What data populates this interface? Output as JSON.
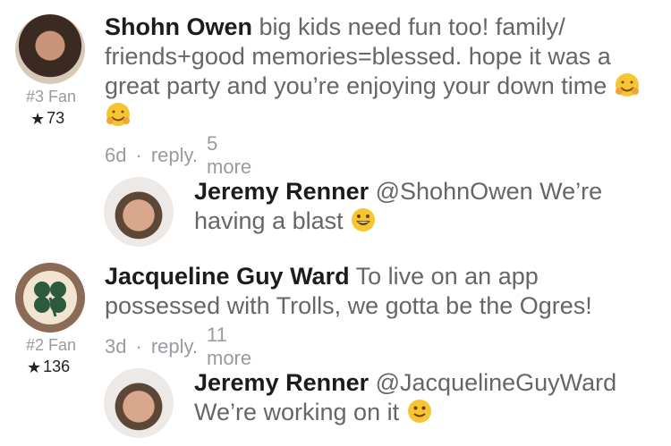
{
  "comments": [
    {
      "author": "Shohn Owen",
      "text": "big kids need fun too! family/ friends+good memories=blessed. hope it was a great party and you’re enjoying your down time",
      "fan_rank": "#3 Fan",
      "fan_score": "73",
      "time": "6d",
      "reply": "reply",
      "more": "5 more",
      "emoji": [
        "hugging-face-icon",
        "hugging-face-icon"
      ]
    },
    {
      "author": "Jeremy Renner",
      "mention": "@ShohnOwen",
      "text": "We’re having a blast",
      "emoji": [
        "grinning-face-icon"
      ]
    },
    {
      "author": "Jacqueline Guy Ward",
      "text": "To live on an app possessed with Trolls, we gotta be the Ogres!",
      "fan_rank": "#2 Fan",
      "fan_score": "136",
      "time": "3d",
      "reply": "reply",
      "more": "11 more"
    },
    {
      "author": "Jeremy Renner",
      "mention": "@JacquelineGuyWard",
      "text": "We’re working on it",
      "emoji": [
        "slightly-smiling-face-icon"
      ]
    }
  ]
}
